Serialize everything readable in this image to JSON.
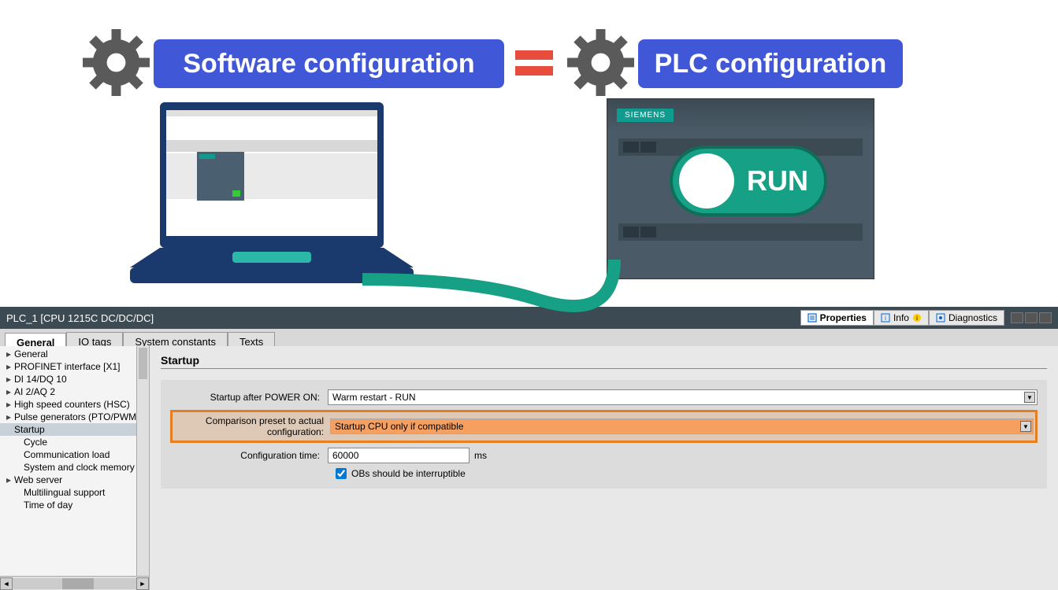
{
  "diagram": {
    "software_badge": "Software configuration",
    "plc_badge": "PLC configuration",
    "run_label": "RUN",
    "siemens_label": "SIEMENS"
  },
  "panel": {
    "title": "PLC_1 [CPU 1215C DC/DC/DC]",
    "right_tabs": {
      "properties": "Properties",
      "info": "Info",
      "diagnostics": "Diagnostics"
    },
    "subtabs": {
      "general": "General",
      "io_tags": "IO tags",
      "system_constants": "System constants",
      "texts": "Texts"
    }
  },
  "tree": {
    "items": [
      {
        "label": "General",
        "expandable": true
      },
      {
        "label": "PROFINET interface [X1]",
        "expandable": true
      },
      {
        "label": "DI 14/DQ 10",
        "expandable": true
      },
      {
        "label": "AI 2/AQ 2",
        "expandable": true
      },
      {
        "label": "High speed counters (HSC)",
        "expandable": true
      },
      {
        "label": "Pulse generators (PTO/PWM)",
        "expandable": true
      },
      {
        "label": "Startup",
        "expandable": false,
        "selected": true
      },
      {
        "label": "Cycle",
        "expandable": false,
        "child": true
      },
      {
        "label": "Communication load",
        "expandable": false,
        "child": true
      },
      {
        "label": "System and clock memory",
        "expandable": false,
        "child": true
      },
      {
        "label": "Web server",
        "expandable": true
      },
      {
        "label": "Multilingual support",
        "expandable": false,
        "child": true
      },
      {
        "label": "Time of day",
        "expandable": false,
        "child": true
      }
    ]
  },
  "form": {
    "section": "Startup",
    "startup_after_label": "Startup after POWER ON:",
    "startup_after_value": "Warm restart - RUN",
    "comparison_label": "Comparison preset to actual configuration:",
    "comparison_value": "Startup CPU only if compatible",
    "config_time_label": "Configuration time:",
    "config_time_value": "60000",
    "config_time_unit": "ms",
    "obs_label": "OBs should be interruptible"
  }
}
